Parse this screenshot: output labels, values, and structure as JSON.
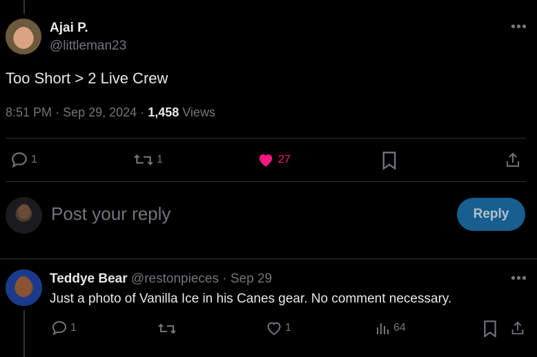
{
  "tweet": {
    "author_name": "Ajai P.",
    "author_handle": "@littleman23",
    "text": "Too Short > 2 Live Crew",
    "time": "8:51 PM",
    "date": "Sep 29, 2024",
    "views_count": "1,458",
    "views_label": "Views",
    "replies": "1",
    "retweets": "1",
    "likes": "27",
    "more_icon": "more-icon"
  },
  "composer": {
    "placeholder": "Post your reply",
    "button_label": "Reply"
  },
  "reply": {
    "author_name": "Teddye Bear",
    "author_handle": "@restonpieces",
    "date": "Sep 29",
    "text": "Just a photo of Vanilla Ice in his Canes gear. No comment necessary.",
    "replies": "1",
    "retweets": "",
    "likes": "1",
    "views": "64"
  },
  "colors": {
    "background": "#000000",
    "text": "#e7e9ea",
    "muted": "#71767b",
    "like": "#f91880",
    "accent": "#1d9bf0"
  }
}
